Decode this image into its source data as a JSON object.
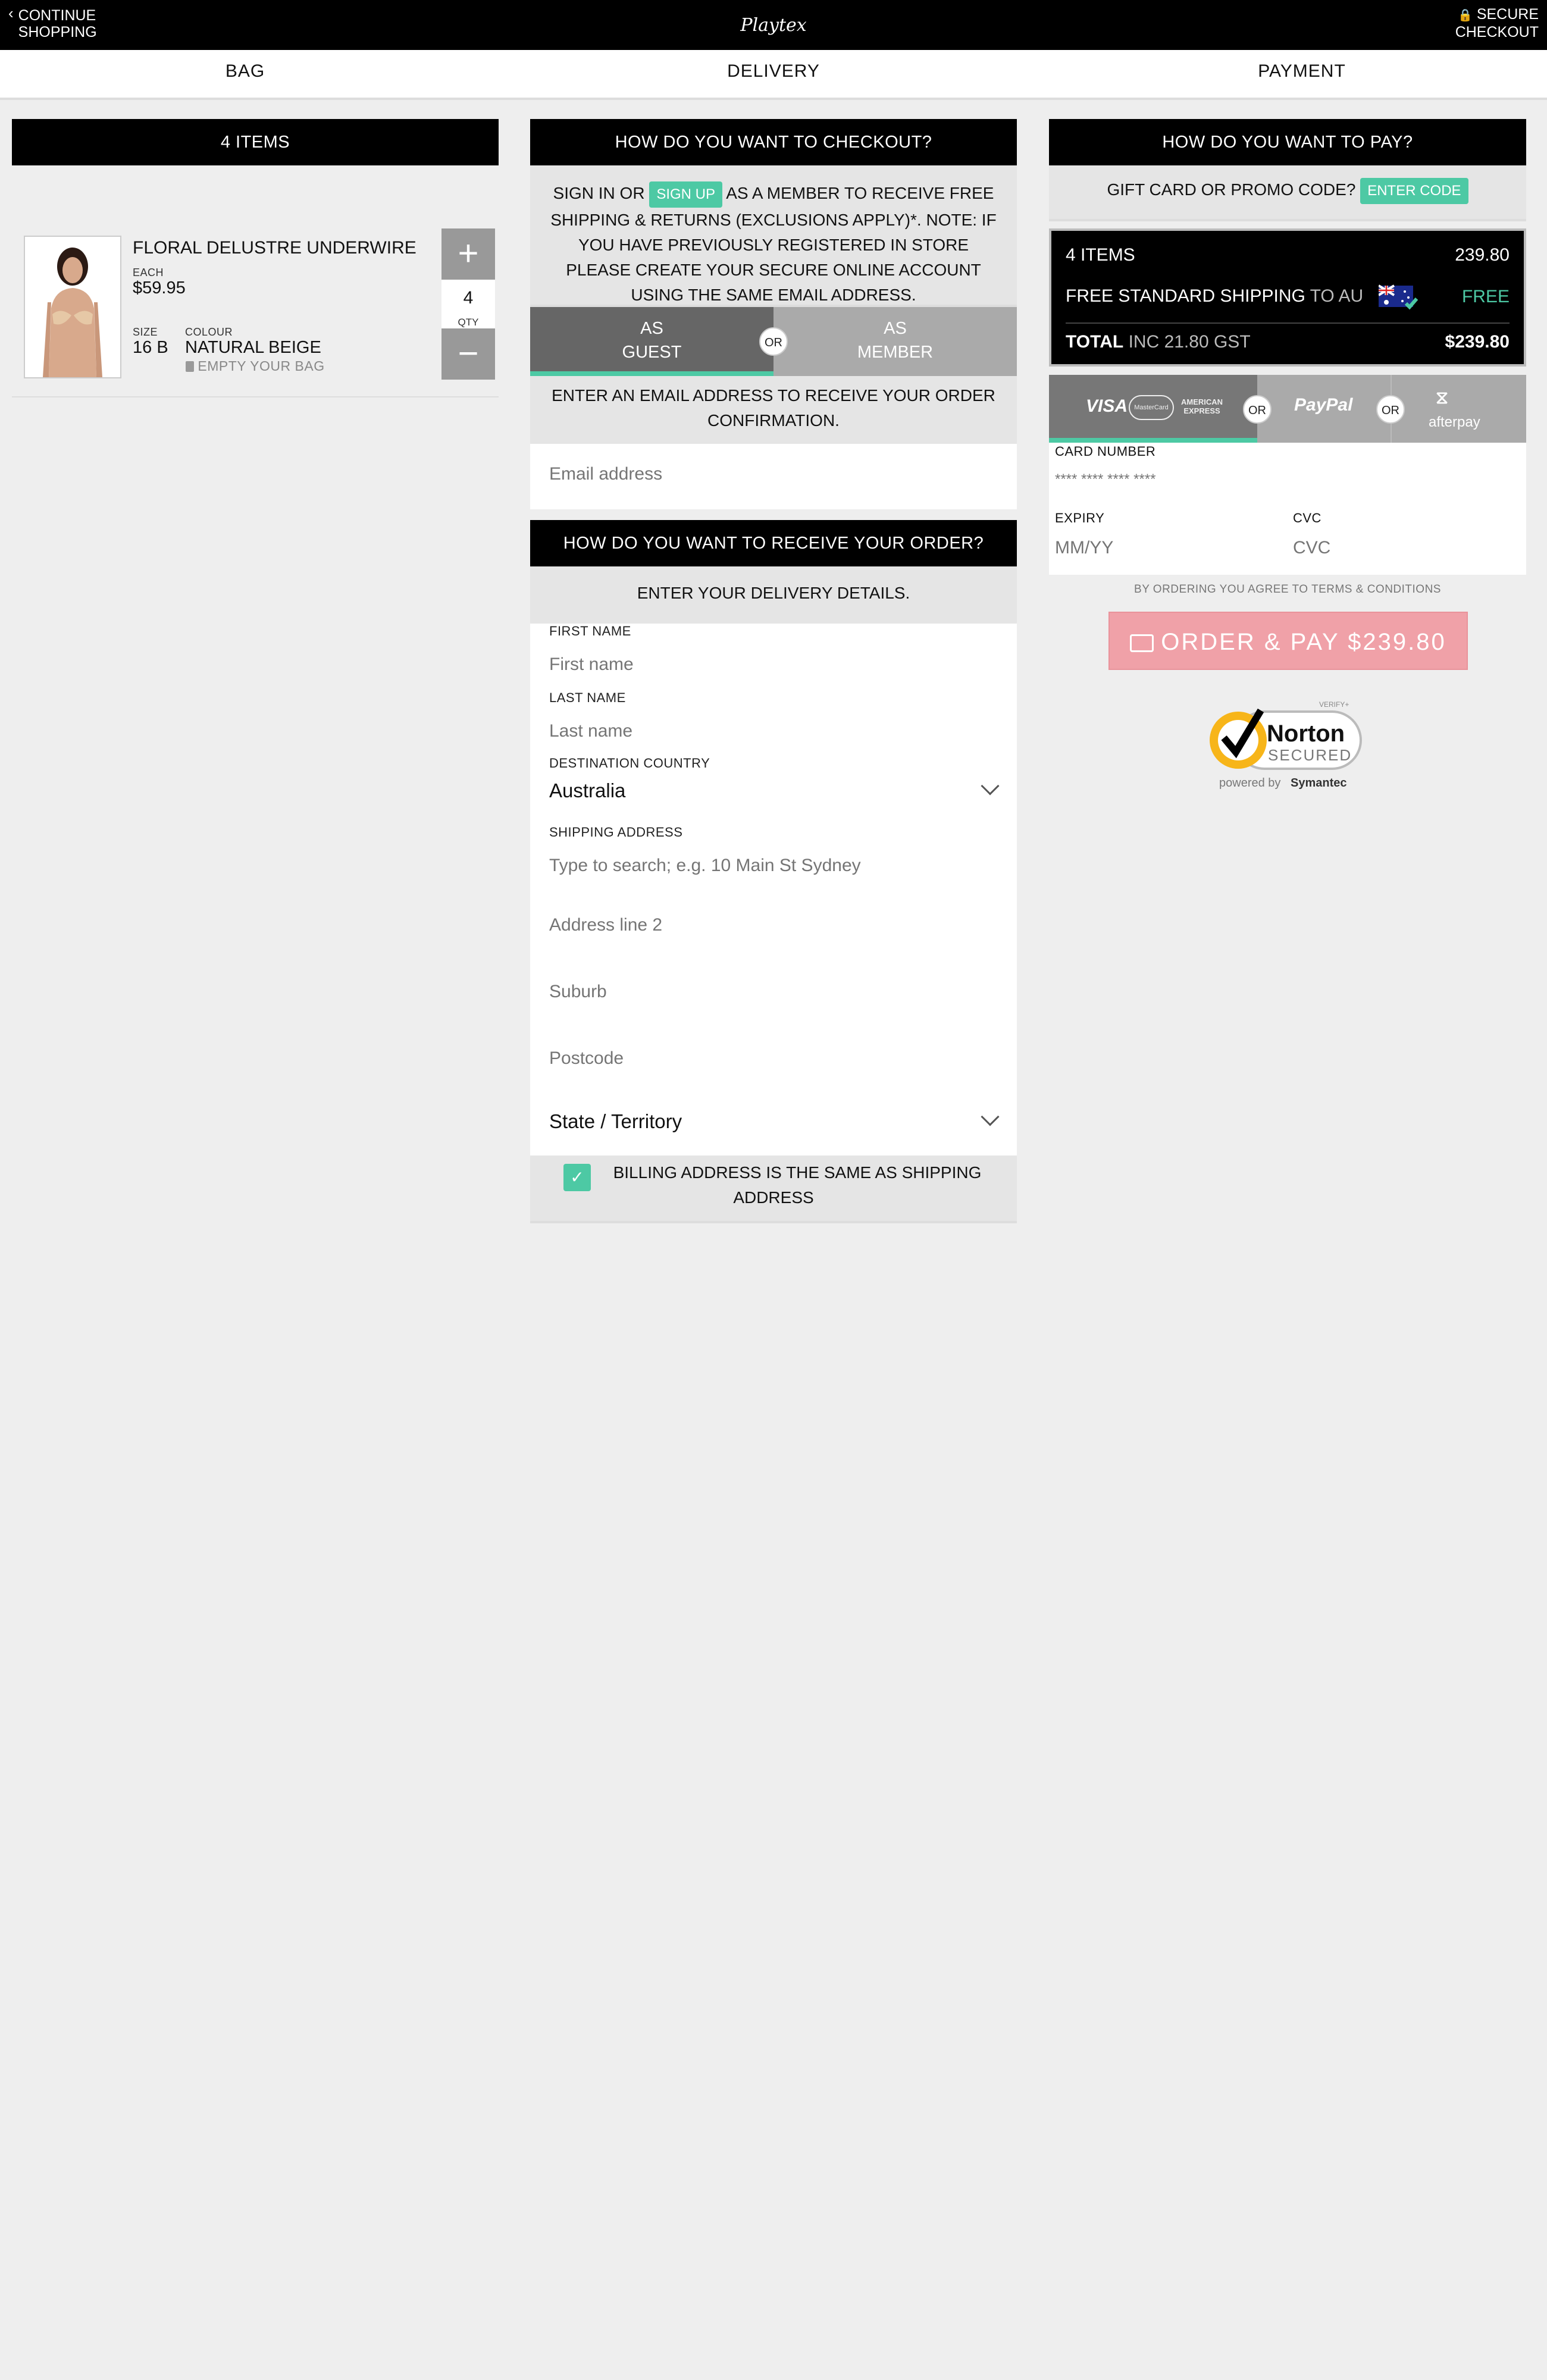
{
  "header": {
    "continue_line1": "CONTINUE",
    "continue_line2": "SHOPPING",
    "logo_text": "Playtex",
    "secure_line1": "SECURE",
    "secure_line2": "CHECKOUT"
  },
  "steps": [
    "BAG",
    "DELIVERY",
    "PAYMENT"
  ],
  "bag": {
    "header": "4 ITEMS",
    "item": {
      "name": "FLORAL DELUSTRE UNDERWIRE",
      "each_label": "EACH",
      "price": "$59.95",
      "size_label": "SIZE",
      "size": "16 B",
      "colour_label": "COLOUR",
      "colour": "NATURAL BEIGE",
      "qty": "4",
      "qty_label": "QTY",
      "plus": "+",
      "minus": "−"
    },
    "empty_label": "EMPTY YOUR BAG"
  },
  "checkout": {
    "header": "HOW DO YOU WANT TO CHECKOUT?",
    "signin_prefix": "SIGN IN OR",
    "signup_button": "SIGN UP",
    "signin_line1_rest": "AS A MEMBER TO RECEIVE FREE",
    "signin_line2": "SHIPPING & RETURNS (EXCLUSIONS APPLY)*. NOTE: IF",
    "signin_line3": "YOU HAVE PREVIOUSLY REGISTERED IN STORE",
    "signin_line4": "PLEASE CREATE YOUR SECURE ONLINE ACCOUNT",
    "signin_line5": "USING THE SAME EMAIL ADDRESS.",
    "guest_line1": "AS",
    "guest_line2": "GUEST",
    "member_line1": "AS",
    "member_line2": "MEMBER",
    "or": "OR",
    "email_note_line1": "ENTER AN EMAIL ADDRESS TO RECEIVE YOUR ORDER",
    "email_note_line2": "CONFIRMATION.",
    "email_placeholder": "Email address"
  },
  "delivery": {
    "header": "HOW DO YOU WANT TO RECEIVE YOUR ORDER?",
    "note": "ENTER YOUR DELIVERY DETAILS.",
    "first_name_label": "FIRST NAME",
    "first_name_placeholder": "First name",
    "last_name_label": "LAST NAME",
    "last_name_placeholder": "Last name",
    "country_label": "DESTINATION COUNTRY",
    "country_value": "Australia",
    "address_label": "SHIPPING ADDRESS",
    "address_placeholder": "Type to search; e.g. 10 Main St Sydney",
    "address2_placeholder": "Address line 2",
    "suburb_placeholder": "Suburb",
    "postcode_placeholder": "Postcode",
    "state_value": "State / Territory",
    "billing_line1": "BILLING ADDRESS IS THE SAME AS SHIPPING",
    "billing_line2": "ADDRESS",
    "billing_checked": true
  },
  "payment": {
    "header": "HOW DO YOU WANT TO PAY?",
    "promo_label": "GIFT CARD OR PROMO CODE?",
    "promo_button": "ENTER CODE",
    "items_label": "4 ITEMS",
    "items_value": "239.80",
    "shipping_label": "FREE STANDARD SHIPPING",
    "shipping_to": "TO AU",
    "shipping_value": "FREE",
    "total_label": "TOTAL",
    "total_gst": "INC 21.80 GST",
    "total_value": "$239.80",
    "or": "OR",
    "visa": "VISA",
    "mastercard": "MasterCard",
    "amex_line1": "AMERICAN",
    "amex_line2": "EXPRESS",
    "paypal": "PayPal",
    "afterpay": "afterpay",
    "card_number_label": "CARD NUMBER",
    "card_number_placeholder": "**** **** **** ****",
    "expiry_label": "EXPIRY",
    "expiry_placeholder": "MM/YY",
    "cvc_label": "CVC",
    "cvc_placeholder": "CVC",
    "terms": "BY ORDERING YOU AGREE TO TERMS & CONDITIONS",
    "order_button": "ORDER & PAY $239.80",
    "norton_verify": "VERIFY+",
    "norton_name": "Norton",
    "norton_secured": "SECURED",
    "norton_powered": "powered by",
    "norton_symantec": "Symantec"
  },
  "colors": {
    "accent": "#4dc9a4",
    "order_button": "#f0a1a8",
    "header_bg": "#000000",
    "page_bg": "#eeeeee"
  }
}
